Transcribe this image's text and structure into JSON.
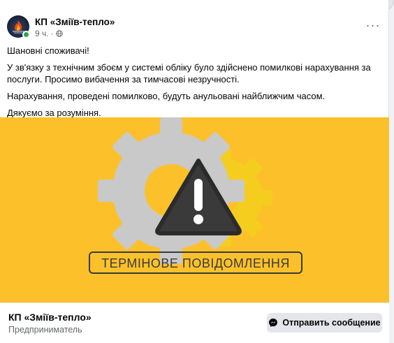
{
  "post": {
    "page_name": "КП «Зміїв-тепло»",
    "time": "9 ч.",
    "separator": "·",
    "audience_icon": "globe-icon",
    "more_icon": "more-horizontal-icon",
    "more_label": "···",
    "paragraphs": [
      "Шановні споживачі!",
      "У зв'язку з технічним збоєм у системі обліку було здійснено помилкові нарахування за послуги. Просимо вибачення за тимчасові незручності.",
      "Нарахування, проведені помилково, будуть анульовані найближчим часом.",
      "Дякуємо за розуміння."
    ]
  },
  "image": {
    "banner_text": "ТЕРМІНОВЕ ПОВІДОМЛЕННЯ",
    "background_color": "#fcc12a",
    "warning_icon": "warning-triangle-icon",
    "gear_icon": "gear-icon"
  },
  "footer": {
    "page_name": "КП «Зміїв-тепло»",
    "category": "Предприниматель",
    "message_button": "Отправить сообщение",
    "message_icon": "messenger-icon"
  },
  "colors": {
    "online": "#31a24c",
    "secondary_text": "#65676b",
    "button_bg": "#e4e6eb"
  }
}
